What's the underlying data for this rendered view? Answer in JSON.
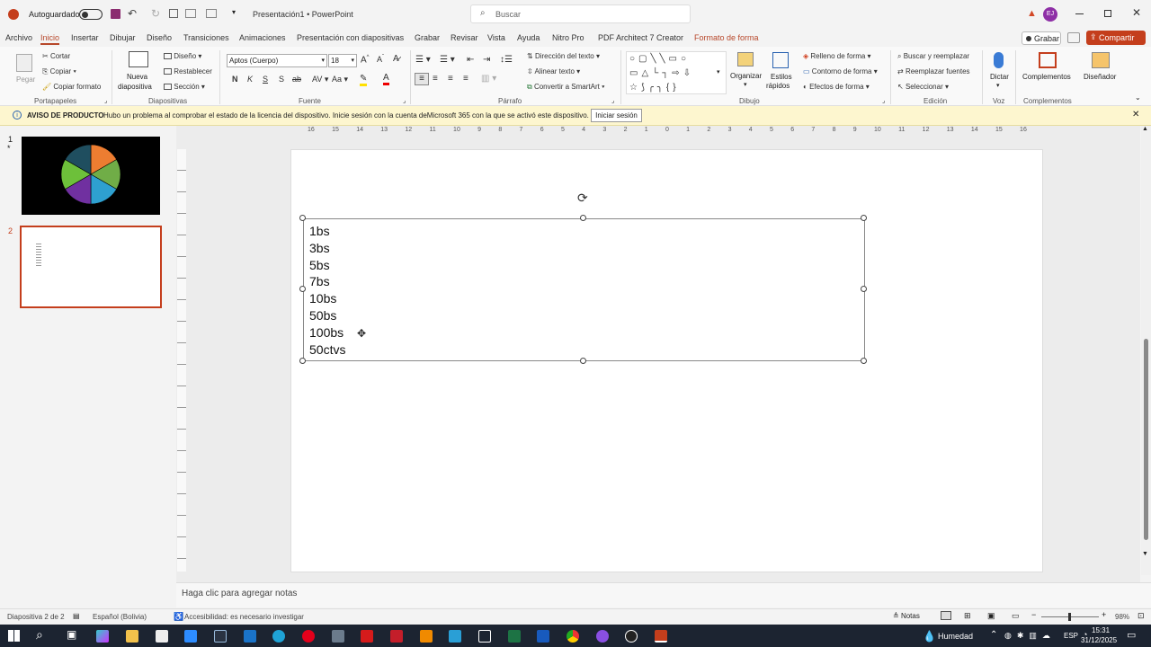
{
  "titlebar": {
    "autosave": "Autoguardado",
    "doc": "Presentación1",
    "sep": "•",
    "app": "PowerPoint",
    "search": "Buscar",
    "avatar": "EJ"
  },
  "tabs": [
    "Archivo",
    "Inicio",
    "Insertar",
    "Dibujar",
    "Diseño",
    "Transiciones",
    "Animaciones",
    "Presentación con diapositivas",
    "Grabar",
    "Revisar",
    "Vista",
    "Ayuda",
    "Nitro Pro",
    "PDF Architect 7 Creator",
    "Formato de forma"
  ],
  "actions": {
    "record": "Grabar",
    "share": "Compartir"
  },
  "ribbon": {
    "clipboard": {
      "paste": "Pegar",
      "cut": "Cortar",
      "copy": "Copiar",
      "format": "Copiar formato",
      "label": "Portapapeles"
    },
    "slides": {
      "new": "Nueva",
      "new2": "diapositiva",
      "layout": "Diseño",
      "reset": "Restablecer",
      "section": "Sección",
      "label": "Diapositivas"
    },
    "font": {
      "name": "Aptos (Cuerpo)",
      "size": "18",
      "bold": "N",
      "italic": "K",
      "underline": "S",
      "strike": "S",
      "label": "Fuente"
    },
    "paragraph": {
      "dir": "Dirección del texto",
      "align": "Alinear texto",
      "smartart": "Convertir a SmartArt",
      "label": "Párrafo"
    },
    "drawing": {
      "arrange": "Organizar",
      "styles": "Estilos",
      "styles2": "rápidos",
      "fill": "Relleno de forma",
      "outline": "Contorno de forma",
      "effects": "Efectos de forma",
      "label": "Dibujo"
    },
    "editing": {
      "find": "Buscar y reemplazar",
      "replace": "Reemplazar fuentes",
      "select": "Seleccionar",
      "label": "Edición"
    },
    "voice": {
      "dictate": "Dictar",
      "label": "Voz"
    },
    "addins": {
      "addins": "Complementos",
      "label": "Complementos"
    },
    "designer": {
      "label": "Diseñador"
    }
  },
  "notice": {
    "title": "AVISO DE PRODUCTO",
    "text": "Hubo un problema al comprobar el estado de la licencia del dispositivo. Inicie sesión con la cuenta deMicrosoft 365 con la que se activó este dispositivo.",
    "button": "Iniciar sesión"
  },
  "thumbs": [
    {
      "num": "1",
      "star": "*"
    },
    {
      "num": "2"
    }
  ],
  "pie_colors": [
    "#ed7d31",
    "#70ad47",
    "#2ea0d0",
    "#7030a0",
    "#6dc03a",
    "#1f4e5f"
  ],
  "ruler_ticks": [
    "16",
    "15",
    "14",
    "13",
    "12",
    "11",
    "10",
    "9",
    "8",
    "7",
    "6",
    "5",
    "4",
    "3",
    "2",
    "1",
    "0",
    "1",
    "2",
    "3",
    "4",
    "5",
    "6",
    "7",
    "8",
    "9",
    "10",
    "11",
    "12",
    "13",
    "14",
    "15",
    "16"
  ],
  "textbox": {
    "lines": [
      "1bs",
      "3bs",
      "5bs",
      "7bs",
      "10bs",
      "50bs",
      "100bs",
      "50ctvs"
    ]
  },
  "notes": {
    "placeholder": "Haga clic para agregar notas"
  },
  "status": {
    "slide": "Diapositiva 2 de 2",
    "lang": "Español (Bolivia)",
    "access": "Accesibilidad: es necesario investigar",
    "notes": "Notas",
    "zoom": "98%"
  },
  "taskbar": {
    "weather": "Humedad",
    "lang": "ESP",
    "time": "15:31",
    "date": "31/12/2025"
  }
}
